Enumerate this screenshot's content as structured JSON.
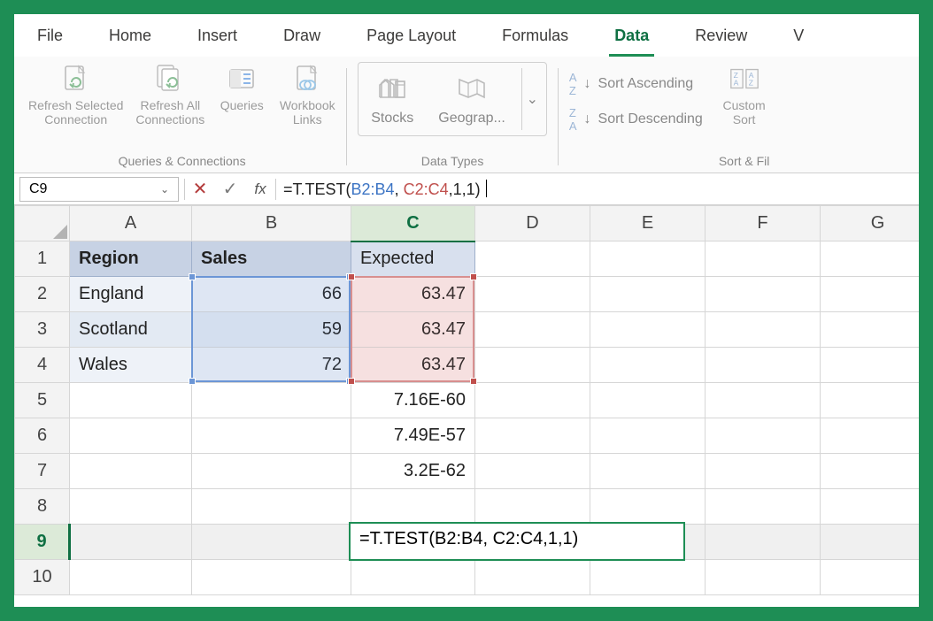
{
  "tabs": {
    "file": "File",
    "home": "Home",
    "insert": "Insert",
    "draw": "Draw",
    "page_layout": "Page Layout",
    "formulas": "Formulas",
    "data": "Data",
    "review": "Review",
    "view": "V"
  },
  "ribbon": {
    "refresh_selected": "Refresh Selected\nConnection",
    "refresh_all": "Refresh All\nConnections",
    "queries": "Queries",
    "workbook_links": "Workbook\nLinks",
    "group_queries": "Queries & Connections",
    "stocks": "Stocks",
    "geography": "Geograp...",
    "group_data_types": "Data Types",
    "sort_asc": "Sort Ascending",
    "sort_desc": "Sort Descending",
    "custom_sort": "Custom\nSort",
    "group_sort": "Sort & Fil"
  },
  "name_box": "C9",
  "columns": [
    "A",
    "B",
    "C",
    "D",
    "E",
    "F",
    "G"
  ],
  "rows": [
    "1",
    "2",
    "3",
    "4",
    "5",
    "6",
    "7",
    "8",
    "9",
    "10"
  ],
  "cells": {
    "A1": "Region",
    "B1": "Sales",
    "C1": "Expected",
    "A2": "England",
    "B2": "66",
    "C2": "63.47",
    "A3": "Scotland",
    "B3": "59",
    "C3": "63.47",
    "A4": "Wales",
    "B4": "72",
    "C4": "63.47",
    "C5": "7.16E-60",
    "C6": "7.49E-57",
    "C7": "3.2E-62",
    "C9": "=T.TEST(B2:B4, C2:C4,1,1)"
  },
  "formula": {
    "prefix": "=T.TEST(",
    "ref1": "B2:B4",
    "mid": ", ",
    "ref2": "C2:C4",
    "suffix": ",1,1)"
  },
  "chart_data": {
    "type": "table",
    "columns": [
      "Region",
      "Sales",
      "Expected"
    ],
    "rows": [
      {
        "Region": "England",
        "Sales": 66,
        "Expected": 63.47
      },
      {
        "Region": "Scotland",
        "Sales": 59,
        "Expected": 63.47
      },
      {
        "Region": "Wales",
        "Sales": 72,
        "Expected": 63.47
      }
    ],
    "extra_values_C": [
      "7.16E-60",
      "7.49E-57",
      "3.2E-62"
    ],
    "active_formula": "=T.TEST(B2:B4, C2:C4,1,1)",
    "active_cell": "C9"
  }
}
